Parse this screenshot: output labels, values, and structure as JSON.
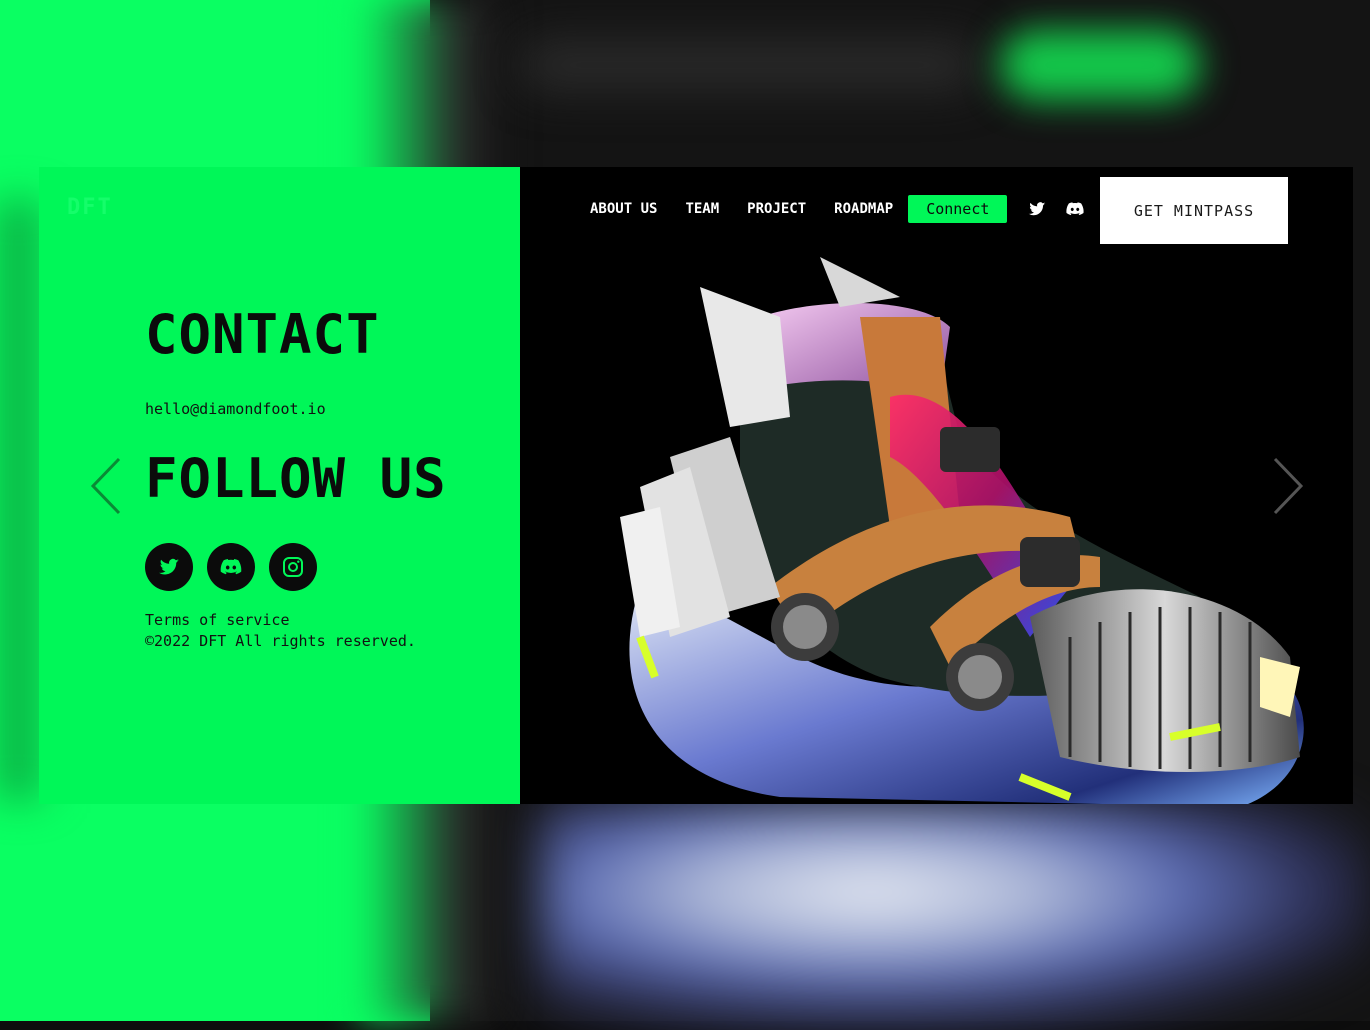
{
  "brand": {
    "logo_text": "DFT"
  },
  "nav": {
    "links": [
      "ABOUT US",
      "TEAM",
      "PROJECT",
      "ROADMAP"
    ],
    "connect_label": "Connect",
    "mintpass_label": "GET MINTPASS",
    "icons": [
      "twitter-icon",
      "discord-icon",
      "instagram-icon"
    ]
  },
  "contact": {
    "title": "CONTACT",
    "email": "hello@diamondfoot.io"
  },
  "follow": {
    "title": "FOLLOW US",
    "icons": [
      "twitter-icon",
      "discord-icon",
      "instagram-icon"
    ]
  },
  "footer": {
    "terms": "Terms of service",
    "copyright": "©2022 DFT All rights reserved."
  },
  "colors": {
    "accent": "#00f758",
    "dark": "#000000",
    "text_dark": "#0b0b0b"
  }
}
